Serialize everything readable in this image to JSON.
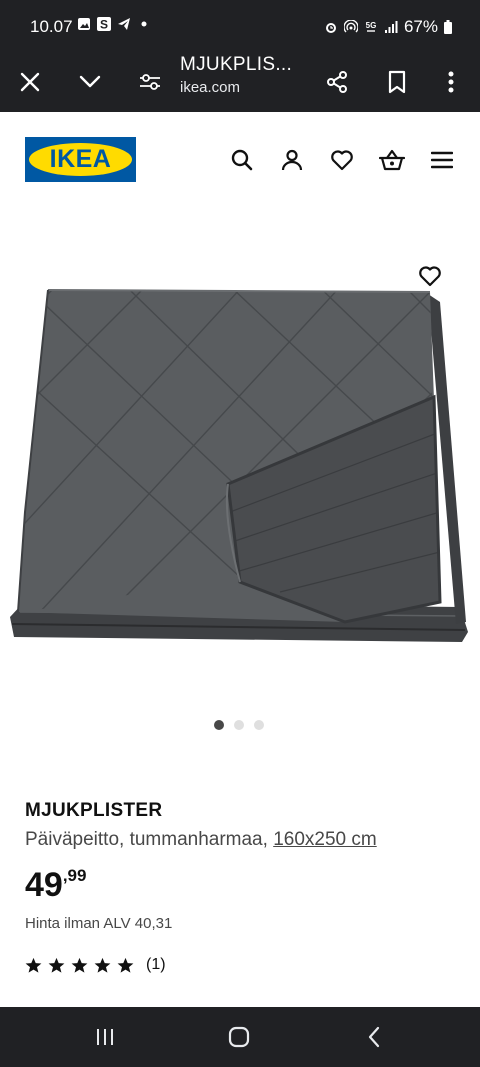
{
  "status_bar": {
    "time": "10.07",
    "battery": "67%"
  },
  "browser": {
    "title": "MJUKPLIS...",
    "url": "ikea.com"
  },
  "header": {
    "logo_text": "IKEA"
  },
  "product": {
    "name": "MJUKPLISTER",
    "description": "Päiväpeitto, tummanharmaa, ",
    "size": "160x250 cm",
    "price_int": "49",
    "price_dec": ",99",
    "vat_text": "Hinta ilman ALV 40,31",
    "rating_stars": 5,
    "rating_count": "(1)"
  },
  "carousel": {
    "total": 3,
    "active": 1
  },
  "colors": {
    "ikea_blue": "#0058a3",
    "ikea_yellow": "#ffdb00",
    "system_bar": "#202124",
    "blanket": "#55585b"
  }
}
